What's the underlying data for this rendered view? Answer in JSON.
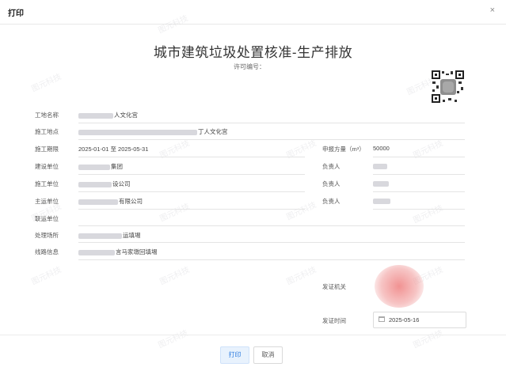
{
  "dialog": {
    "title": "打印",
    "close_icon": "×"
  },
  "watermark": "图元科技",
  "document": {
    "title": "城市建筑垃圾处置核准-生产排放",
    "permit_label": "许可编号："
  },
  "fields": {
    "site_name": {
      "label": "工地名称",
      "value": "人文化宫"
    },
    "construction_address": {
      "label": "施工地点",
      "value": "丁人文化宫"
    },
    "construction_period": {
      "label": "施工期限",
      "value": "2025-01-01 至 2025-05-31"
    },
    "declared_volume": {
      "label": "申报方量（m³）",
      "value": "50000"
    },
    "building_unit": {
      "label": "建设单位",
      "value": "集团"
    },
    "building_person": {
      "label": "负责人",
      "value": ""
    },
    "construction_unit": {
      "label": "施工单位",
      "value": "设公司"
    },
    "construction_person": {
      "label": "负责人",
      "value": ""
    },
    "transport_unit": {
      "label": "主运单位",
      "value": "有限公司"
    },
    "transport_person": {
      "label": "负责人",
      "value": ""
    },
    "joint_unit": {
      "label": "联运单位",
      "value": ""
    },
    "disposal_site": {
      "label": "处理场所",
      "value": "运填埸"
    },
    "route_info": {
      "label": "线路信息",
      "value": "言马家墩回填埸"
    },
    "issuing_authority": {
      "label": "发证机关",
      "value": ""
    },
    "issue_date": {
      "label": "发证时间",
      "value": "2025-05-16"
    }
  },
  "footer": {
    "print_label": "打印",
    "cancel_label": "取消"
  }
}
